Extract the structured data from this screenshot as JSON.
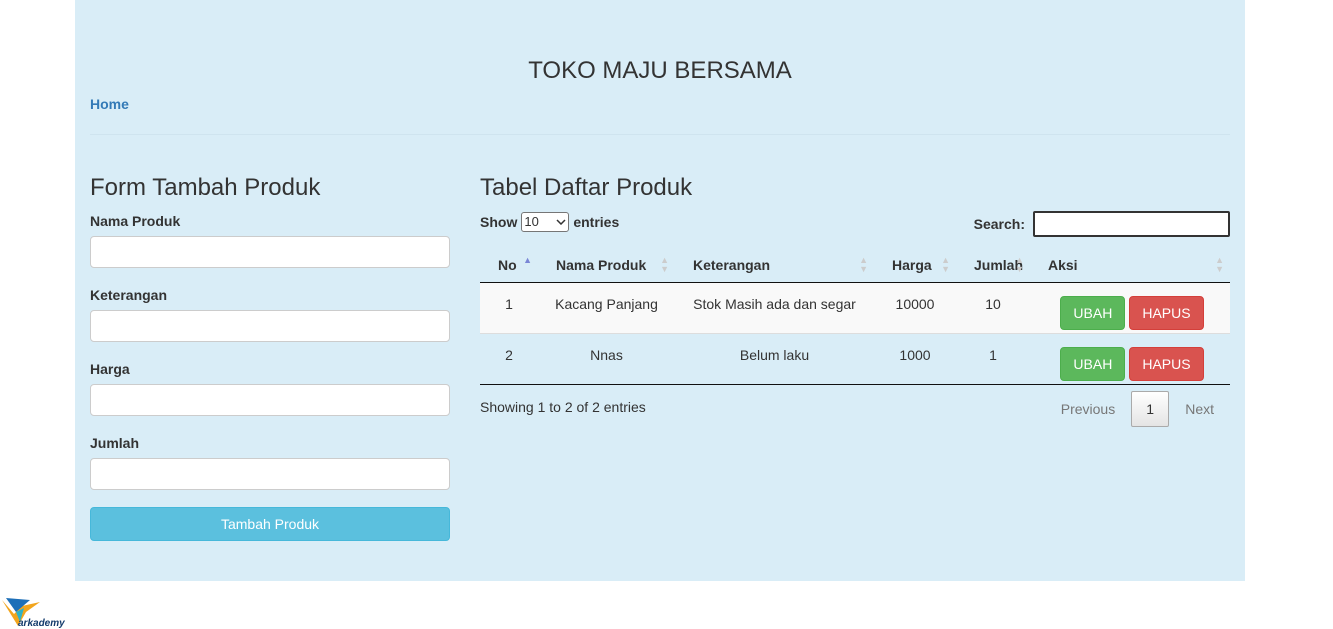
{
  "header": {
    "title": "TOKO MAJU BERSAMA",
    "nav_home": "Home"
  },
  "form": {
    "title": "Form Tambah Produk",
    "fields": [
      {
        "label": "Nama Produk",
        "value": ""
      },
      {
        "label": "Keterangan",
        "value": ""
      },
      {
        "label": "Harga",
        "value": ""
      },
      {
        "label": "Jumlah",
        "value": ""
      }
    ],
    "submit_label": "Tambah Produk"
  },
  "table": {
    "title": "Tabel Daftar Produk",
    "show_label": "Show",
    "page_length": "10",
    "entries_label": "entries",
    "search_label": "Search:",
    "columns": [
      "No",
      "Nama Produk",
      "Keterangan",
      "Harga",
      "Jumlah",
      "Aksi"
    ],
    "rows": [
      {
        "no": "1",
        "nama": "Kacang Panjang",
        "keterangan": "Stok Masih ada dan segar",
        "harga": "10000",
        "jumlah": "10"
      },
      {
        "no": "2",
        "nama": "Nnas",
        "keterangan": "Belum laku",
        "harga": "1000",
        "jumlah": "1"
      }
    ],
    "edit_label": "UBAH",
    "delete_label": "HAPUS",
    "info": "Showing 1 to 2 of 2 entries",
    "pagination": {
      "previous": "Previous",
      "current": "1",
      "next": "Next"
    }
  },
  "colors": {
    "panel": "#d9edf7",
    "primary_btn": "#5bc0de",
    "success": "#5cb85c",
    "danger": "#d9534f",
    "link": "#337ab7"
  },
  "logo": {
    "icon": "bird-logo",
    "text": "arkademy"
  }
}
